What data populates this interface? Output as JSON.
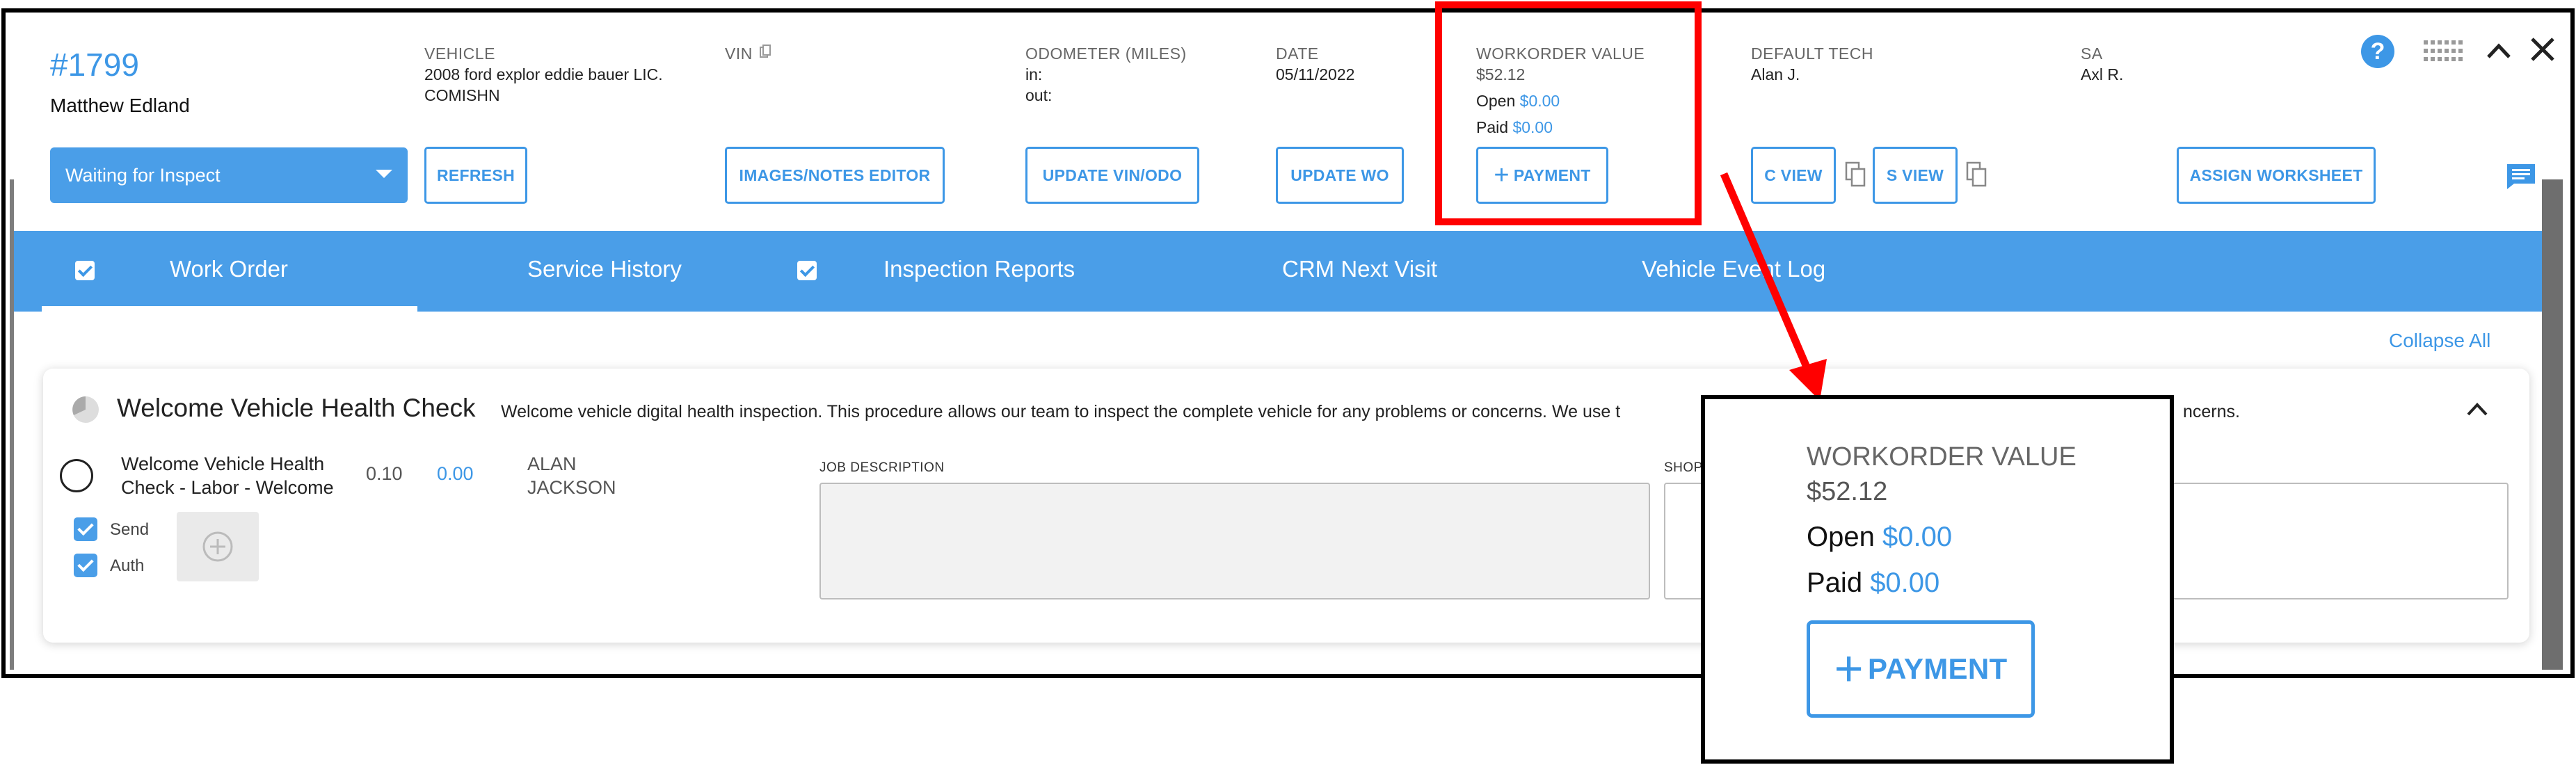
{
  "header": {
    "wo_number": "#1799",
    "customer": "Matthew Edland",
    "vehicle_label": "VEHICLE",
    "vehicle_line1": "2008 ford explor eddie bauer LIC.",
    "vehicle_line2": "COMISHN",
    "vin_label": "VIN",
    "odometer_label": "ODOMETER (MILES)",
    "odometer_in": "in:",
    "odometer_out": "out:",
    "date_label": "DATE",
    "date_value": "05/11/2022",
    "wo_value_label": "WORKORDER VALUE",
    "wo_value": "$52.12",
    "open_label": "Open",
    "open_value": "$0.00",
    "paid_label": "Paid",
    "paid_value": "$0.00",
    "tech_label": "DEFAULT TECH",
    "tech_value": "Alan J.",
    "sa_label": "SA",
    "sa_value": "Axl R."
  },
  "status": {
    "selected": "Waiting for Inspect"
  },
  "buttons": {
    "refresh": "REFRESH",
    "images_notes": "IMAGES/NOTES EDITOR",
    "update_vin": "UPDATE VIN/ODO",
    "update_wo": "UPDATE WO",
    "payment": "PAYMENT",
    "c_view": "C VIEW",
    "s_view": "S VIEW",
    "assign_worksheet": "ASSIGN WORKSHEET"
  },
  "tabs": [
    "Work Order",
    "Service History",
    "Inspection Reports",
    "CRM Next Visit",
    "Vehicle Event Log"
  ],
  "collapse_all": "Collapse All",
  "card": {
    "title": "Welcome Vehicle Health Check",
    "description": "Welcome vehicle digital health inspection. This procedure allows our team to inspect the complete vehicle for any problems or concerns. We use t",
    "description_tail": "ncerns.",
    "job_line1": "Welcome Vehicle Health",
    "job_line2": "Check - Labor - Welcome",
    "hours": "0.10",
    "price": "0.00",
    "tech_line1": "ALAN",
    "tech_line2": "JACKSON",
    "send_label": "Send",
    "auth_label": "Auth",
    "job_description_label": "JOB DESCRIPTION",
    "shop_label": "SHOP"
  },
  "callout": {
    "wo_value_label": "WORKORDER VALUE",
    "wo_value": "$52.12",
    "open_label": "Open",
    "open_value": "$0.00",
    "paid_label": "Paid",
    "paid_value": "$0.00",
    "payment_label": "PAYMENT"
  },
  "colors": {
    "accent": "#3d97e6",
    "tab_bar": "#4a9ee8",
    "highlight": "#ff0000"
  }
}
